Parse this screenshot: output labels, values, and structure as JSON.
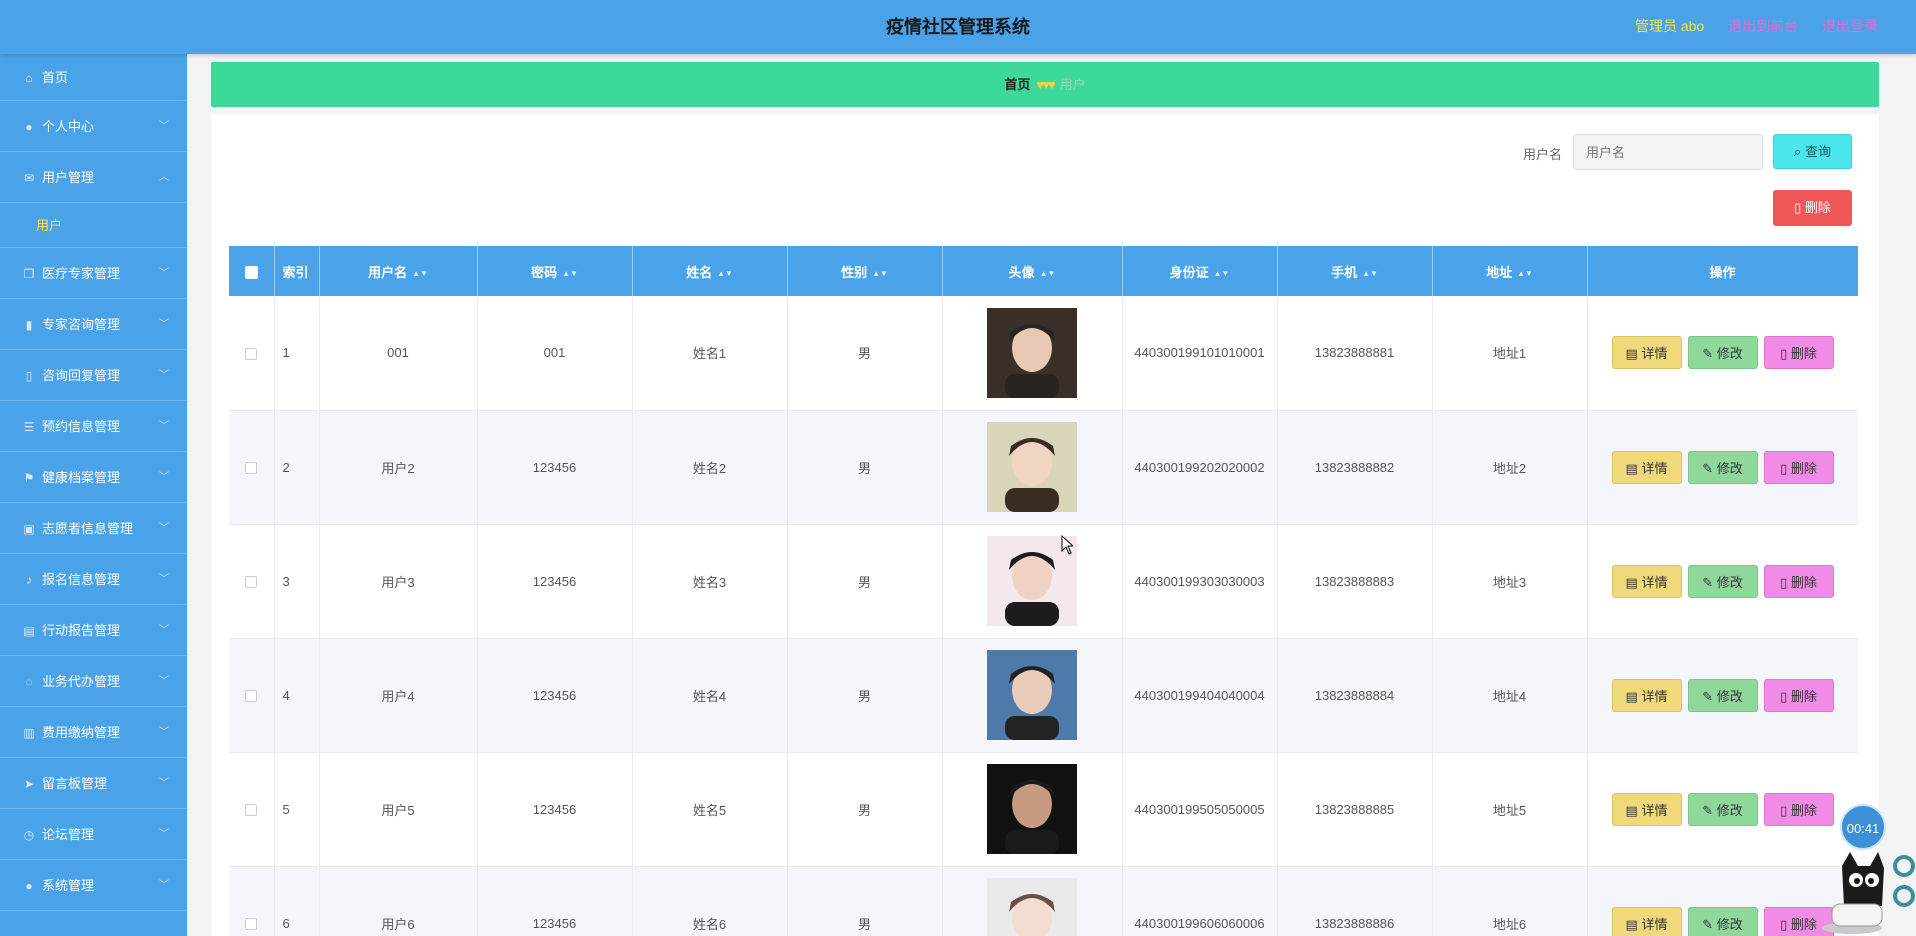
{
  "header": {
    "title": "疫情社区管理系统",
    "admin_label": "管理员 abo",
    "to_frontend": "退出到前台",
    "logout": "退出登录"
  },
  "sidebar": {
    "items": [
      {
        "label": "首页",
        "icon": "home-icon"
      },
      {
        "label": "个人中心",
        "icon": "user-icon"
      },
      {
        "label": "用户管理",
        "icon": "mail-icon"
      },
      {
        "label": "医疗专家管理",
        "icon": "document-icon"
      },
      {
        "label": "专家咨询管理",
        "icon": "bar-chart-icon"
      },
      {
        "label": "咨询回复管理",
        "icon": "phone-icon"
      },
      {
        "label": "预约信息管理",
        "icon": "sliders-icon"
      },
      {
        "label": "健康档案管理",
        "icon": "flag-icon"
      },
      {
        "label": "志愿者信息管理",
        "icon": "clipboard-icon"
      },
      {
        "label": "报名信息管理",
        "icon": "bell-icon"
      },
      {
        "label": "行动报告管理",
        "icon": "stamp-icon"
      },
      {
        "label": "业务代办管理",
        "icon": "power-icon"
      },
      {
        "label": "费用缴纳管理",
        "icon": "receipt-icon"
      },
      {
        "label": "留言板管理",
        "icon": "send-icon"
      },
      {
        "label": "论坛管理",
        "icon": "clock-icon"
      },
      {
        "label": "系统管理",
        "icon": "mic-icon"
      }
    ],
    "submenu_user": "用户"
  },
  "breadcrumb": {
    "home": "首页",
    "current": "用户"
  },
  "search": {
    "label": "用户名",
    "placeholder": "用户名",
    "query_button": "查询",
    "delete_button": "删除"
  },
  "table": {
    "headers": {
      "index": "索引",
      "username": "用户名",
      "password": "密码",
      "name": "姓名",
      "gender": "性别",
      "avatar": "头像",
      "id_card": "身份证",
      "phone": "手机",
      "address": "地址",
      "actions": "操作"
    },
    "action_labels": {
      "detail": "详情",
      "edit": "修改",
      "delete": "删除"
    },
    "rows": [
      {
        "index": "1",
        "username": "001",
        "password": "001",
        "name": "姓名1",
        "gender": "男",
        "id_card": "440300199101010001",
        "phone": "13823888881",
        "address": "地址1"
      },
      {
        "index": "2",
        "username": "用户2",
        "password": "123456",
        "name": "姓名2",
        "gender": "男",
        "id_card": "440300199202020002",
        "phone": "13823888882",
        "address": "地址2"
      },
      {
        "index": "3",
        "username": "用户3",
        "password": "123456",
        "name": "姓名3",
        "gender": "男",
        "id_card": "440300199303030003",
        "phone": "13823888883",
        "address": "地址3"
      },
      {
        "index": "4",
        "username": "用户4",
        "password": "123456",
        "name": "姓名4",
        "gender": "男",
        "id_card": "440300199404040004",
        "phone": "13823888884",
        "address": "地址4"
      },
      {
        "index": "5",
        "username": "用户5",
        "password": "123456",
        "name": "姓名5",
        "gender": "男",
        "id_card": "440300199505050005",
        "phone": "13823888885",
        "address": "地址5"
      },
      {
        "index": "6",
        "username": "用户6",
        "password": "123456",
        "name": "姓名6",
        "gender": "男",
        "id_card": "440300199606060006",
        "phone": "13823888886",
        "address": "地址6"
      }
    ]
  },
  "overlay": {
    "timer": "00:41"
  }
}
